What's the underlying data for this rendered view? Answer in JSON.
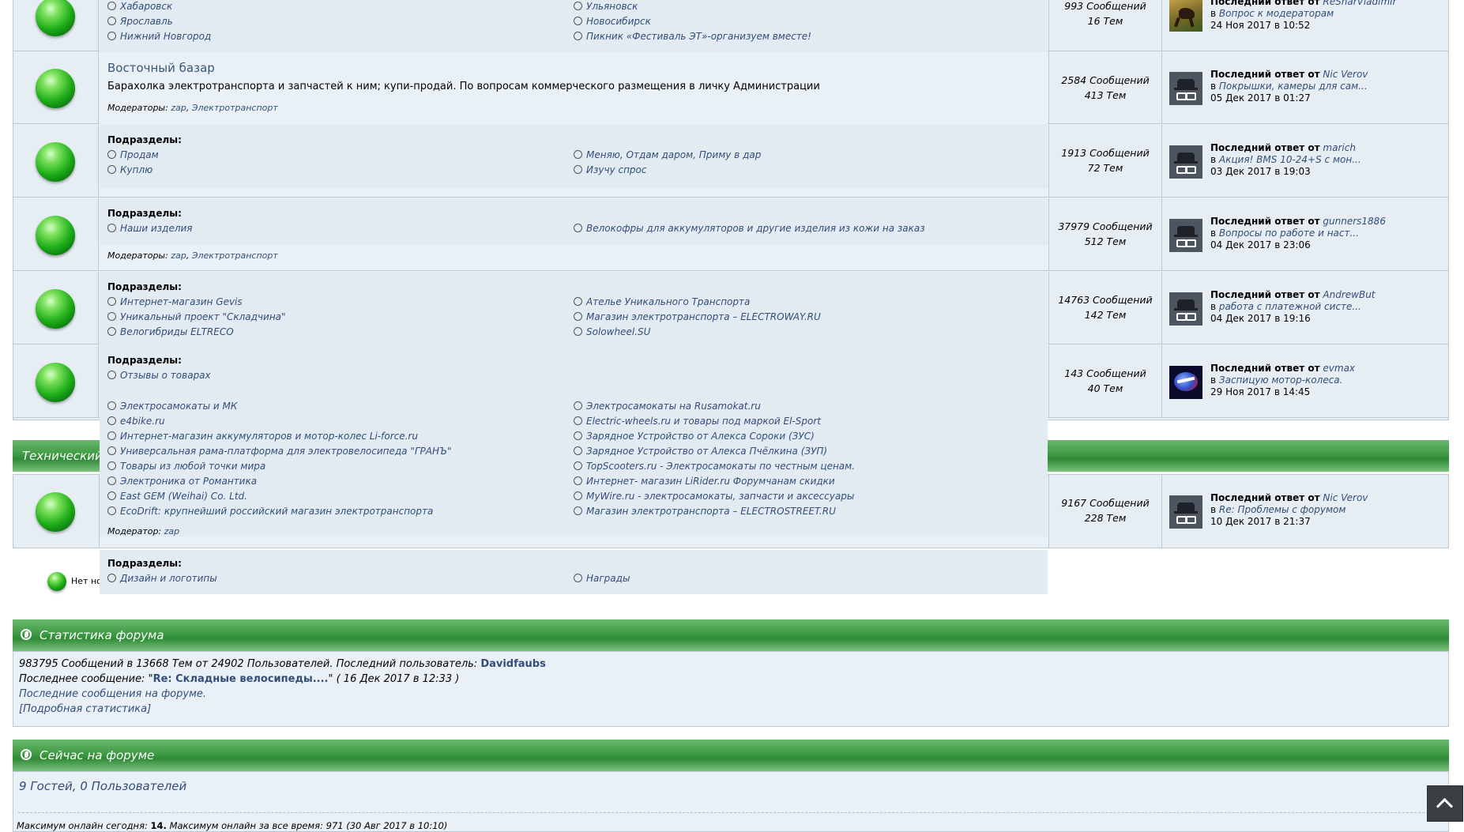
{
  "rows": [
    {
      "subs_left": [
        "Хабаровск",
        "Ярославль",
        "Нижний Новгород"
      ],
      "subs_right": [
        "Ульяновск",
        "Новосибирск",
        "Пикник «Фестиваль ЭТ»-организуем вместе!"
      ],
      "posts": "993 Сообщений",
      "topics": "16 Тем",
      "last_prefix": "Последний ответ от",
      "last_user": "ReSharVladimir",
      "last_in": "в",
      "last_topic": "Вопрос к модераторам",
      "last_date": "24 Ноя 2017 в 10:52",
      "avatar": "horse-avatar"
    },
    {
      "title": "Восточный базар",
      "desc": "Барахолка электротранспорта и запчастей к ним; купи-продай. По вопросам коммерческого размещения в личку Администрации",
      "mods_label": "Модераторы:",
      "mods": [
        "zap",
        "Электротранспорт"
      ],
      "posts": "2584 Сообщений",
      "topics": "413 Тем",
      "last_prefix": "Последний ответ от",
      "last_user": "Nic Verov",
      "last_in": "в",
      "last_topic": "Покрышки, камеры для сам...",
      "last_date": "05 Дек 2017 в 01:27",
      "avatar": "spy-avatar"
    },
    {
      "subs_title": "Подразделы:",
      "subs_left": [
        "Продам",
        "Куплю"
      ],
      "subs_right": [
        "Меняю, Отдам даром, Приму в дар",
        "Изучу спрос"
      ],
      "posts": "1913 Сообщений",
      "topics": "72 Тем",
      "last_prefix": "Последний ответ от",
      "last_user": "marich",
      "last_in": "в",
      "last_topic": "Акция! BMS 10-24+S с мон...",
      "last_date": "03 Дек 2017 в 19:03",
      "avatar": "spy-avatar"
    },
    {
      "subs_title": "Подразделы:",
      "subs_left": [
        "Наши изделия"
      ],
      "subs_right": [
        "Велокофры для аккумуляторов и другие изделия из кожи на заказ"
      ],
      "mods_label": "Модераторы:",
      "mods": [
        "zap",
        "Электротранспорт"
      ],
      "posts": "37979 Сообщений",
      "topics": "512 Тем",
      "last_prefix": "Последний ответ от",
      "last_user": "gunners1886",
      "last_in": "в",
      "last_topic": "Вопросы по работе и наст...",
      "last_date": "04 Дек 2017 в 23:06",
      "avatar": "spy-avatar"
    },
    {
      "subs_title": "Подразделы:",
      "subs_left": [
        "Интернет-магазин Gevis",
        "Уникальный проект \"Складчина\"",
        "Велогибриды ELTRECO"
      ],
      "subs_right": [
        "Ателье Уникального Транспорта",
        "Магазин электротранспорта – ELECTROWAY.RU",
        "Solowheel.SU"
      ],
      "posts": "14763 Сообщений",
      "topics": "142 Тем",
      "last_prefix": "Последний ответ от",
      "last_user": "AndrewBut",
      "last_in": "в",
      "last_topic": "работа с платежной систе...",
      "last_date": "04 Дек 2017 в 19:16",
      "avatar": "spy-avatar"
    },
    {
      "subs_title": "Подразделы:",
      "subs_left": [
        "Отзывы о товарах"
      ],
      "posts": "143 Сообщений",
      "topics": "40 Тем",
      "last_prefix": "Последний ответ от",
      "last_user": "evmax",
      "last_in": "в",
      "last_topic": "Заспицую мотор-колеса.",
      "last_date": "29 Ноя 2017 в 14:45",
      "avatar": "logo-avatar"
    }
  ],
  "overflow_panel": {
    "subs_left": [
      "Электросамокаты и МК",
      "e4bike.ru",
      "Интернет-магазин аккумуляторов и мотор-колес Li-force.ru",
      "Универсальная рама-платформа для электровелосипеда \"ГРАНЪ\"",
      "Товары из любой точки мира",
      "Электроника от Романтика",
      "East GEM (Weihai) Co. Ltd.",
      "EcoDrift: крупнейший российский магазин электротранспорта"
    ],
    "subs_right": [
      "Электросамокаты на Rusamokat.ru",
      "Electric-wheels.ru и товары под маркой El-Sport",
      "Зарядное Устройство от Алекса Сороки (ЗУС)",
      "Зарядное Устройство от Алекса Пчёлкина (ЗУП)",
      "TopScooters.ru - Электросамокаты по честным ценам.",
      "Интернет- магазин LiRider.ru Форумчанам скидки",
      "MyWire.ru - электросамокаты, запчасти и аксессуары",
      "Магазин электротранспорта – ELECTROSTREET.RU"
    ],
    "mod_label": "Модератор:",
    "mod": "zap"
  },
  "tech_section": {
    "title": "Технический",
    "posts": "9167 Сообщений",
    "topics": "228 Тем",
    "last_prefix": "Последний ответ от",
    "last_user": "Nic Verov",
    "last_in": "в",
    "last_topic": "Re: Проблемы с форумом",
    "last_date": "10 Дек 2017 в 21:37",
    "avatar": "spy-avatar"
  },
  "tech_subs_panel": {
    "subs_title": "Подразделы:",
    "subs_left": [
      "Дизайн и логотипы"
    ],
    "subs_right": [
      "Награды"
    ]
  },
  "legend": {
    "text": "Нет нов"
  },
  "stats": {
    "title": "Статистика форума",
    "line1_prefix": "983795 Сообщений в 13668 Тем от 24902 Пользователей. Последний пользователь:",
    "line1_user": "Davidfaubs",
    "line2_prefix": "Последнее сообщение: \"",
    "line2_link": "Re: Складные велосипеды....",
    "line2_suffix": "\" ( 16 Дек 2017 в 12:33 )",
    "line3": "Последние сообщения на форуме.",
    "line4": "[Подробная статистика]"
  },
  "online": {
    "title": "Сейчас на форуме",
    "guests": "9 Гостей, 0 Пользователей",
    "max_prefix": "Максимум онлайн сегодня:",
    "max_today": "14.",
    "max_all_prefix": "Максимум онлайн за все время:",
    "max_all": "971 (30 Авг 2017 в 10:10)"
  },
  "colors": {
    "green_bar": "#3f9a44",
    "link": "#334d7a",
    "panel_bg": "#e9f1f7"
  }
}
